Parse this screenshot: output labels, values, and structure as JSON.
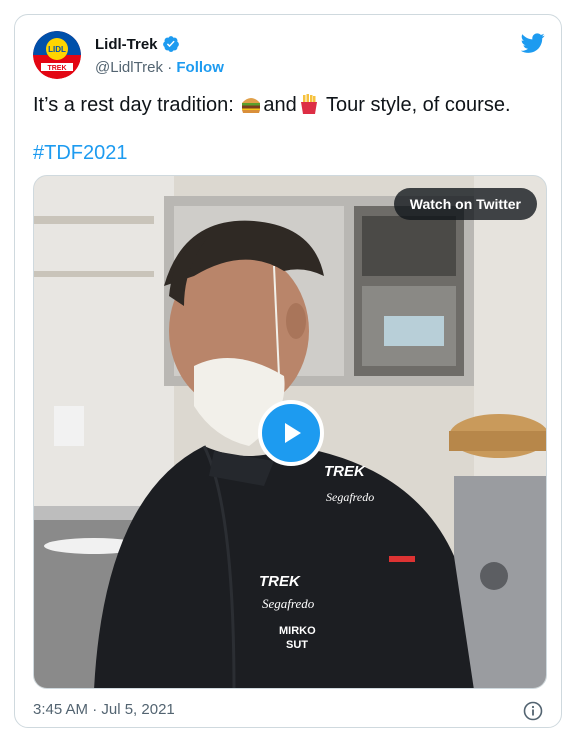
{
  "tweet": {
    "display_name": "Lidl-Trek",
    "handle": "@LidlTrek",
    "separator": " · ",
    "follow_label": "Follow",
    "text_before": "It’s a rest day tradition: ",
    "text_middle": "and",
    "text_after": " Tour style, of course.",
    "emoji_1": "hamburger-emoji",
    "emoji_2": "fries-emoji",
    "hashtag": "#TDF2021",
    "watch_label": "Watch on Twitter",
    "timestamp": "3:45 AM · Jul 5, 2021",
    "avatar_label_top": "LIDL",
    "avatar_label_bottom": "TREK",
    "shirt_brand": "TREK",
    "shirt_sponsor": "Segafredo",
    "shirt_name_1": "MIRKO",
    "shirt_name_2": "SUT"
  },
  "colors": {
    "accent": "#1d9bf0",
    "text": "#0f1419",
    "secondary": "#536471",
    "border": "#cfd9de"
  },
  "icons": [
    "verified-badge-icon",
    "twitter-bird-icon",
    "play-icon",
    "info-icon"
  ]
}
